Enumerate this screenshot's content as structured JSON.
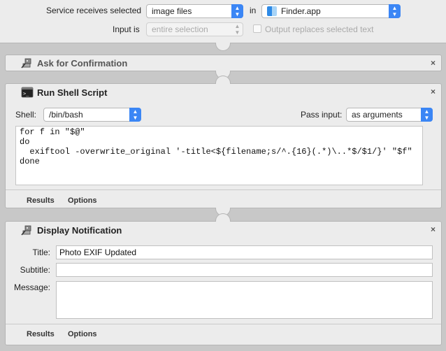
{
  "header": {
    "service_label": "Service receives selected",
    "service_value": "image files",
    "in_label": "in",
    "app_value": "Finder.app",
    "input_label": "Input is",
    "input_value": "entire selection",
    "replace_label": "Output replaces selected text"
  },
  "actions": {
    "confirm": {
      "title": "Ask for Confirmation"
    },
    "shell": {
      "title": "Run Shell Script",
      "shell_label": "Shell:",
      "shell_value": "/bin/bash",
      "pass_label": "Pass input:",
      "pass_value": "as arguments",
      "script": "for f in \"$@\"\ndo\n  exiftool -overwrite_original '-title<${filename;s/^.{16}(.*)\\..*$/$1/}' \"$f\"\ndone",
      "results_tab": "Results",
      "options_tab": "Options"
    },
    "notify": {
      "title": "Display Notification",
      "title_label": "Title:",
      "title_value": "Photo EXIF Updated",
      "subtitle_label": "Subtitle:",
      "subtitle_value": "",
      "message_label": "Message:",
      "message_value": "",
      "results_tab": "Results",
      "options_tab": "Options"
    }
  },
  "close_glyph": "×",
  "icons": {
    "chevron": "up-down-chevron-icon",
    "finder": "finder-icon",
    "automator": "automator-robot-icon",
    "terminal": "terminal-icon"
  },
  "colors": {
    "accent": "#3b86f5",
    "panel_bg": "#ececec",
    "canvas_bg": "#c8c8c8"
  }
}
